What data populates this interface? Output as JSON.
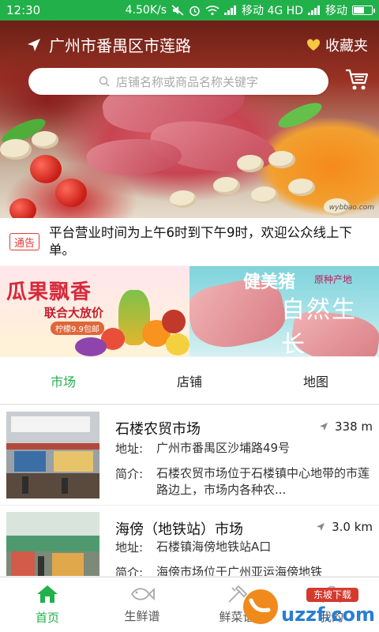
{
  "status_bar": {
    "time": "12:30",
    "net_speed": "4.50K/s",
    "carrier1": "移动 4G HD",
    "carrier2": "移动",
    "battery_level": 0.6
  },
  "header": {
    "location": "广州市番禺区市莲路",
    "favorites_label": "收藏夹",
    "search_placeholder": "店铺名称或商品名称关键字",
    "watermark": "wybbao.com"
  },
  "notice": {
    "tag": "通告",
    "text": "平台营业时间为上午6时到下午9时，欢迎公众线上下单。"
  },
  "promos": {
    "left": {
      "title": "瓜果飘香",
      "subtitle": "联合大放价",
      "badge": "柠檬9.9包邮"
    },
    "right": {
      "title": "健美猪",
      "origin": "原种产地",
      "slogan": "自然生长"
    }
  },
  "tabs": [
    {
      "label": "市场",
      "active": true
    },
    {
      "label": "店铺",
      "active": false
    },
    {
      "label": "地图",
      "active": false
    }
  ],
  "markets": [
    {
      "name": "石楼农贸市场",
      "distance": "338 m",
      "address_label": "地址:",
      "address": "广州市番禺区沙埔路49号",
      "intro_label": "简介:",
      "intro": "石楼农贸市场位于石楼镇中心地带的市莲路边上，市场内各种农..."
    },
    {
      "name": "海傍（地铁站）市场",
      "distance": "3.0 km",
      "address_label": "地址:",
      "address": "石楼镇海傍地铁站A口",
      "intro_label": "简介:",
      "intro": "海傍市场位于广州亚运海傍地铁"
    }
  ],
  "bottom_nav": [
    {
      "label": "首页",
      "icon": "home-icon",
      "active": true
    },
    {
      "label": "生鲜谱",
      "icon": "fish-icon",
      "active": false
    },
    {
      "label": "鲜菜谱",
      "icon": "recipe-icon",
      "active": false
    },
    {
      "label": "我的",
      "icon": "user-icon",
      "active": false
    }
  ],
  "overlay_watermark": {
    "line1": "东坡下载",
    "line2": "uzzf.com"
  },
  "colors": {
    "accent": "#22b04b",
    "notice_red": "#e53935"
  }
}
